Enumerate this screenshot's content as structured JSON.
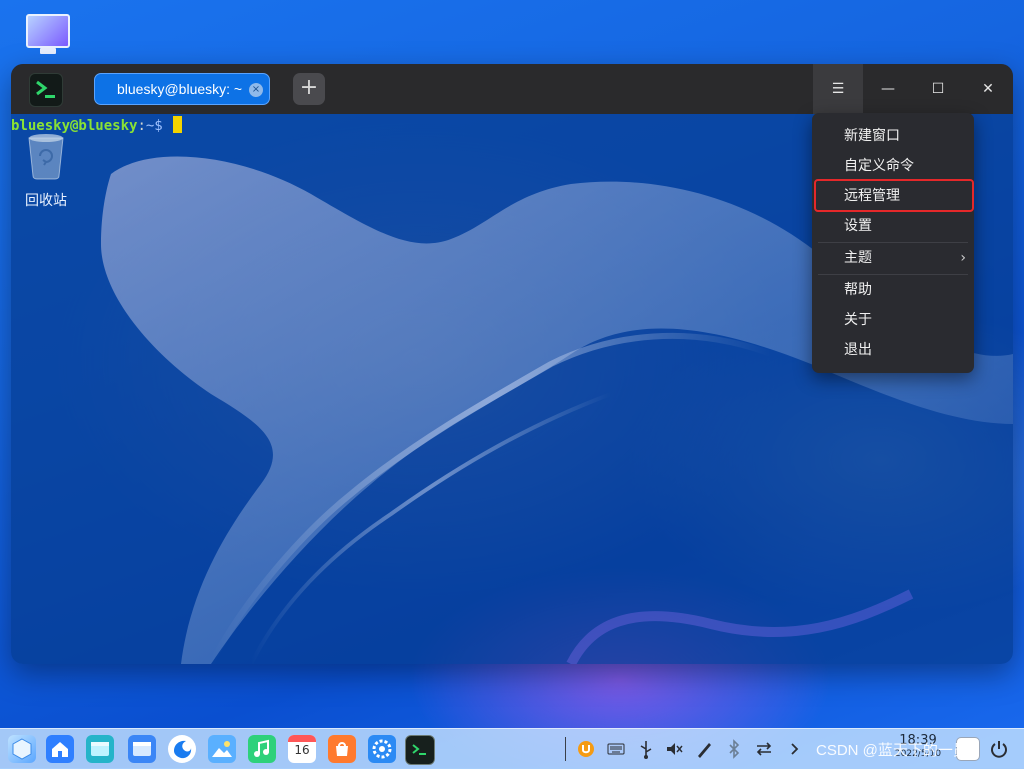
{
  "desktop": {
    "trash_label": "回收站"
  },
  "terminal": {
    "tab_label": "bluesky@bluesky: ~",
    "tab_close_glyph": "×",
    "new_tab_glyph": "+",
    "prompt": {
      "user_host": "bluesky@bluesky",
      "separator": ":",
      "path": "~$"
    },
    "window_buttons": {
      "menu": "☰",
      "minimize": "—",
      "maximize": "☐",
      "close": "✕"
    }
  },
  "context_menu": {
    "items": [
      {
        "label": "新建窗口"
      },
      {
        "label": "自定义命令"
      },
      {
        "label": "远程管理",
        "highlighted": true
      },
      {
        "label": "设置"
      },
      {
        "label": "主题",
        "submenu": true,
        "arrow": "›"
      },
      {
        "label": "帮助"
      },
      {
        "label": "关于"
      },
      {
        "label": "退出"
      }
    ]
  },
  "taskbar": {
    "apps": [
      "launcher-icon",
      "home-icon",
      "file-manager-icon",
      "browser-icon",
      "image-viewer-icon",
      "music-icon",
      "calendar-icon",
      "app-store-icon",
      "settings-icon",
      "terminal-icon"
    ],
    "calendar_day": "16",
    "tray": [
      "onboard-icon",
      "keyboard-icon",
      "usb-icon",
      "volume-muted-icon",
      "pen-icon",
      "bluetooth-icon",
      "network-icon",
      "chevron-right-icon"
    ],
    "clock": {
      "time": "18:39",
      "date": "2022/5/10"
    }
  },
  "watermark": "CSDN @蓝天下的一员",
  "colors": {
    "tab_active": "#0d72e6",
    "prompt_user": "#8ae234",
    "cursor": "#f3d400",
    "highlight_box": "#e5282a"
  }
}
